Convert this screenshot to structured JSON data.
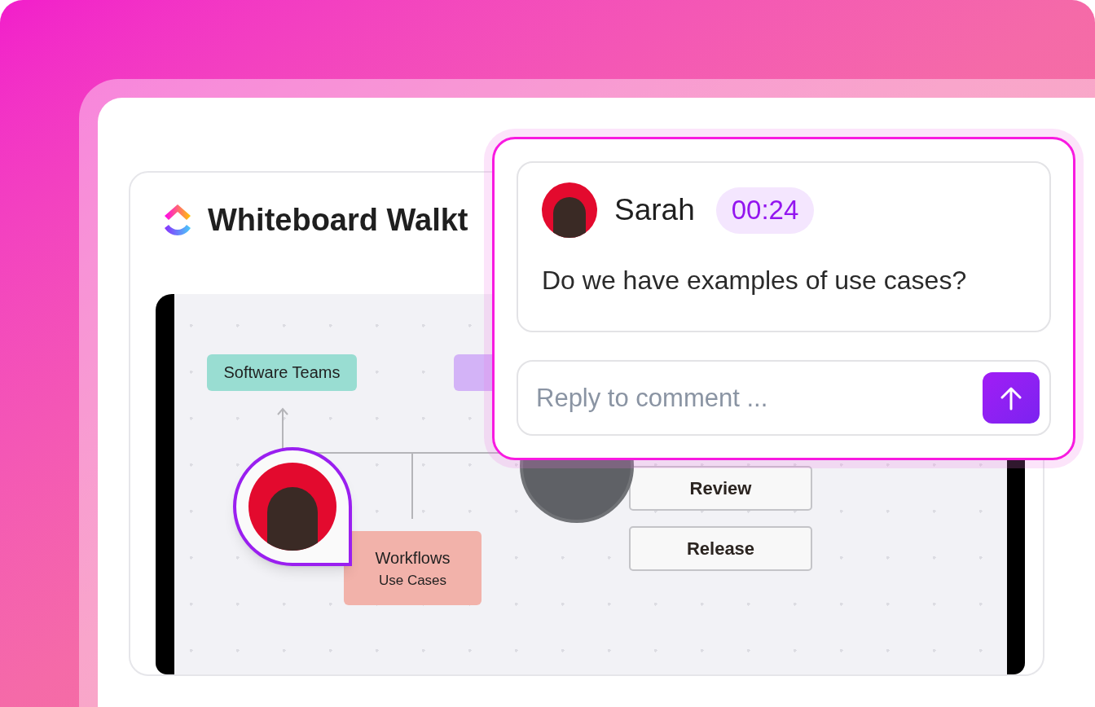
{
  "board": {
    "title": "Whiteboard Walkt",
    "nodes": [
      {
        "kind": "sticky",
        "lines": [
          "Software Teams"
        ],
        "color": "#99ddd2"
      },
      {
        "kind": "sticky",
        "color": "#d3b3f7"
      },
      {
        "kind": "sticky",
        "lines": [
          "Workflows",
          "Use Cases"
        ],
        "color": "#f2b2aa"
      },
      {
        "kind": "outline",
        "lines": [
          "Review"
        ]
      },
      {
        "kind": "outline",
        "lines": [
          "Release"
        ]
      },
      {
        "kind": "circle"
      },
      {
        "kind": "avatar-pin"
      }
    ]
  },
  "comment": {
    "author": "Sarah",
    "timestamp": "00:24",
    "text": "Do we have examples of use cases?"
  },
  "reply": {
    "placeholder": "Reply to comment ..."
  }
}
